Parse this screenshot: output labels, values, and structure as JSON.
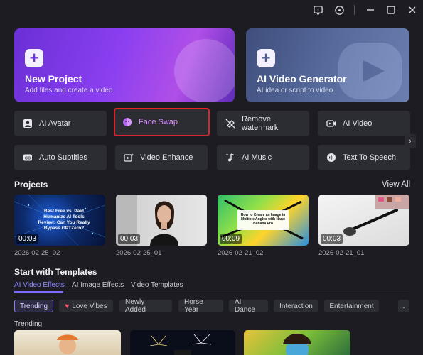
{
  "titlebar": {
    "feedback_icon": "message-icon",
    "settings_icon": "target-icon",
    "minimize_icon": "minimize-icon",
    "maximize_icon": "maximize-icon",
    "close_icon": "close-icon"
  },
  "hero": {
    "new_project": {
      "title": "New Project",
      "subtitle": "Add files and create a video"
    },
    "ai_video_generator": {
      "title": "AI Video Generator",
      "subtitle": "AI idea or script to video"
    }
  },
  "tools": {
    "row1": [
      {
        "label": "AI Avatar",
        "icon": "avatar-icon"
      },
      {
        "label": "Face Swap",
        "icon": "face-swap-icon",
        "selected": true
      },
      {
        "label": "Remove watermark",
        "icon": "eraser-icon"
      },
      {
        "label": "AI Video",
        "icon": "ai-video-icon"
      }
    ],
    "row2": [
      {
        "label": "Auto Subtitles",
        "icon": "cc-icon"
      },
      {
        "label": "Video Enhance",
        "icon": "video-enhance-icon"
      },
      {
        "label": "AI Music",
        "icon": "music-icon"
      },
      {
        "label": "Text To Speech",
        "icon": "speech-icon"
      }
    ]
  },
  "projects": {
    "title": "Projects",
    "view_all": "View All",
    "items": [
      {
        "name": "2026-02-25_02",
        "duration": "00:03",
        "thumb_text": "Best Free vs. Paid Humanize AI Tools Review: Can You Really Bypass GPTZero?"
      },
      {
        "name": "2026-02-25_01",
        "duration": "00:03",
        "thumb_text": ""
      },
      {
        "name": "2026-02-21_02",
        "duration": "00:09",
        "thumb_text": "How to Create an Image in Multiple Angles with Nano Banana Pro"
      },
      {
        "name": "2026-02-21_01",
        "duration": "00:03",
        "thumb_text": ""
      }
    ]
  },
  "templates": {
    "title": "Start with Templates",
    "tabs": [
      "AI Video Effects",
      "AI Image Effects",
      "Video Templates"
    ],
    "chips": [
      "Trending",
      "Love Vibes",
      "Newly Added",
      "Horse Year",
      "AI Dance",
      "Interaction",
      "Entertainment"
    ],
    "subsection": "Trending"
  },
  "colors": {
    "accent": "#7c6cff",
    "selected_border": "#e0242c",
    "background": "#1c1c22"
  }
}
